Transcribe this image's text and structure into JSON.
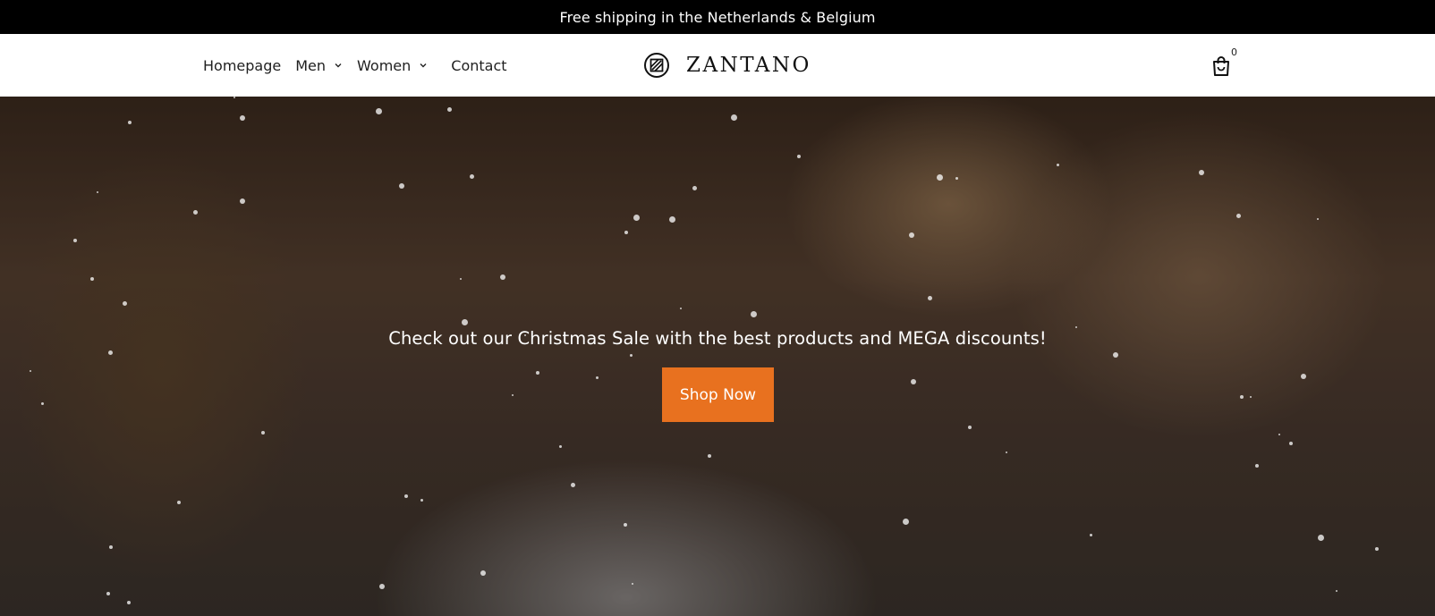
{
  "announcement": {
    "text": "Free shipping in the Netherlands & Belgium"
  },
  "nav": {
    "items": [
      {
        "label": "Homepage",
        "has_dropdown": false
      },
      {
        "label": "Men",
        "has_dropdown": true
      },
      {
        "label": "Women",
        "has_dropdown": true
      },
      {
        "label": "Contact",
        "has_dropdown": false
      }
    ]
  },
  "logo": {
    "text": "ZANTANO",
    "icon": "zantano-logo-mark"
  },
  "cart": {
    "icon": "shopping-bag-icon",
    "count": "0"
  },
  "hero": {
    "headline": "Check out our Christmas Sale with the best products and MEGA discounts!",
    "cta_label": "Shop Now",
    "cta_color": "#e8711f"
  },
  "colors": {
    "announcement_bg": "#000000",
    "header_bg": "#ffffff",
    "accent": "#e8711f"
  }
}
